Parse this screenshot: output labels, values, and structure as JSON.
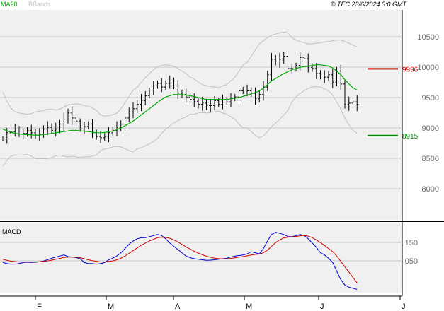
{
  "header": {
    "ma_label": "MA20",
    "bbands_label": "BBands",
    "timestamp": "© TEC 23/6/2024 3:0 GMT"
  },
  "macd_label": "MACD",
  "colors": {
    "background": "#ffffff",
    "plot_area": "#f0f0f0",
    "grid": "#c8c8c8",
    "price_bars": "#000000",
    "ma20": "#00aa00",
    "bbands": "#c0c0c0",
    "resistance": "#cc0000",
    "support": "#008800",
    "macd_line": "#0000cc",
    "signal_line": "#cc0000"
  },
  "chart_data": [
    {
      "type": "ohlc",
      "title": "",
      "x_tick_labels": [
        "F",
        "M",
        "A",
        "M",
        "J",
        "J"
      ],
      "y_tick_labels": [
        "10500",
        "10000",
        "9500",
        "9000",
        "8500",
        "8000"
      ],
      "ylim": [
        7550,
        10950
      ],
      "grid": true,
      "overlays": [
        "MA20",
        "BBands"
      ],
      "levels": [
        {
          "name": "resistance",
          "value": 9996,
          "label": "9996"
        },
        {
          "name": "support",
          "value": 8915,
          "label": "8915"
        }
      ],
      "series": [
        {
          "name": "Price",
          "closes": [
            8860,
            8960,
            8980,
            9020,
            8940,
            8950,
            9000,
            8960,
            8920,
            8940,
            9020,
            9050,
            9000,
            9020,
            9100,
            9180,
            9280,
            9200,
            9150,
            9020,
            9060,
            9100,
            8960,
            8900,
            8880,
            8900,
            8960,
            9000,
            9050,
            9100,
            9200,
            9300,
            9350,
            9420,
            9480,
            9560,
            9650,
            9720,
            9760,
            9700,
            9760,
            9800,
            9720,
            9600,
            9580,
            9540,
            9500,
            9470,
            9420,
            9440,
            9400,
            9400,
            9480,
            9420,
            9500,
            9460,
            9520,
            9540,
            9640,
            9650,
            9640,
            9600,
            9510,
            9580,
            9700,
            9900,
            10150,
            10120,
            10150,
            10200,
            10000,
            10000,
            10050,
            10180,
            10160,
            10020,
            10000,
            9920,
            9880,
            9860,
            9900,
            9780,
            9960,
            9750,
            9420,
            9440,
            9460,
            9420
          ]
        },
        {
          "name": "MA20",
          "values": [
            9020,
            8990,
            8970,
            8950,
            8940,
            8935,
            8930,
            8925,
            8920,
            8925,
            8930,
            8940,
            8950,
            8960,
            8970,
            8980,
            8990,
            9000,
            9000,
            8990,
            8985,
            8980,
            8970,
            8960,
            8960,
            8965,
            8975,
            8990,
            9010,
            9040,
            9075,
            9110,
            9150,
            9200,
            9250,
            9300,
            9350,
            9400,
            9450,
            9500,
            9540,
            9560,
            9580,
            9580,
            9575,
            9570,
            9560,
            9545,
            9530,
            9515,
            9500,
            9500,
            9500,
            9500,
            9500,
            9500,
            9510,
            9520,
            9530,
            9550,
            9570,
            9590,
            9610,
            9640,
            9680,
            9740,
            9800,
            9840,
            9880,
            9920,
            9950,
            9980,
            10000,
            10020,
            10030,
            10040,
            10050,
            10060,
            10060,
            10050,
            10040,
            10010,
            9960,
            9900,
            9820,
            9750,
            9690,
            9650
          ]
        },
        {
          "name": "BBands upper",
          "values": [
            9620,
            9470,
            9360,
            9300,
            9280,
            9270,
            9260,
            9270,
            9300,
            9310,
            9320,
            9340,
            9340,
            9330,
            9340,
            9380,
            9410,
            9420,
            9430,
            9420,
            9400,
            9390,
            9360,
            9320,
            9250,
            9230,
            9240,
            9250,
            9280,
            9350,
            9450,
            9550,
            9650,
            9700,
            9780,
            9850,
            9920,
            9980,
            10030,
            10050,
            10060,
            10050,
            10040,
            10000,
            9960,
            9920,
            9860,
            9830,
            9780,
            9740,
            9720,
            9710,
            9700,
            9690,
            9720,
            9740,
            9800,
            9860,
            9960,
            10060,
            10100,
            10200,
            10300,
            10400,
            10450,
            10500,
            10540,
            10560,
            10580,
            10590,
            10580,
            10500,
            10460,
            10440,
            10420,
            10400,
            10400,
            10410,
            10420,
            10430,
            10440,
            10450,
            10460,
            10460,
            10440,
            10410,
            10380,
            10350
          ]
        },
        {
          "name": "BBands lower",
          "values": [
            8420,
            8510,
            8580,
            8600,
            8600,
            8600,
            8610,
            8580,
            8540,
            8540,
            8540,
            8540,
            8560,
            8590,
            8600,
            8580,
            8570,
            8580,
            8570,
            8560,
            8570,
            8570,
            8580,
            8600,
            8670,
            8700,
            8710,
            8730,
            8740,
            8730,
            8700,
            8670,
            8650,
            8700,
            8720,
            8750,
            8780,
            8820,
            8870,
            8950,
            9020,
            9070,
            9120,
            9160,
            9190,
            9220,
            9260,
            9260,
            9280,
            9290,
            9280,
            9290,
            9300,
            9310,
            9280,
            9260,
            9220,
            9180,
            9100,
            9040,
            9040,
            8980,
            8920,
            8880,
            8910,
            8980,
            9060,
            9120,
            9180,
            9250,
            9320,
            9460,
            9540,
            9600,
            9640,
            9680,
            9700,
            9710,
            9700,
            9670,
            9640,
            9570,
            9460,
            9340,
            9200,
            9090,
            9000,
            8950
          ]
        }
      ]
    },
    {
      "type": "line",
      "title": "MACD",
      "y_tick_labels": [
        "150",
        "050"
      ],
      "ylim": [
        -300,
        350
      ],
      "grid": true,
      "series": [
        {
          "name": "MACD",
          "values": [
            -20,
            -30,
            -35,
            -35,
            -30,
            -20,
            -18,
            -20,
            -18,
            -14,
            -6,
            6,
            20,
            30,
            40,
            50,
            35,
            30,
            25,
            15,
            -20,
            -30,
            -30,
            -35,
            -30,
            -20,
            5,
            20,
            40,
            70,
            110,
            150,
            180,
            200,
            210,
            210,
            220,
            230,
            240,
            230,
            200,
            160,
            130,
            100,
            70,
            40,
            25,
            15,
            10,
            5,
            0,
            2,
            5,
            10,
            15,
            20,
            30,
            40,
            45,
            50,
            60,
            80,
            70,
            60,
            110,
            180,
            240,
            260,
            250,
            240,
            220,
            220,
            230,
            240,
            230,
            200,
            160,
            120,
            70,
            50,
            20,
            -20,
            -100,
            -180,
            -230,
            -250,
            -260,
            -270
          ]
        },
        {
          "name": "Signal",
          "values": [
            10,
            0,
            -8,
            -12,
            -15,
            -16,
            -16,
            -16,
            -15,
            -13,
            -10,
            -5,
            2,
            10,
            18,
            27,
            30,
            31,
            29,
            25,
            15,
            5,
            -3,
            -10,
            -15,
            -15,
            -10,
            -5,
            5,
            20,
            40,
            65,
            90,
            115,
            140,
            160,
            180,
            195,
            210,
            215,
            213,
            205,
            190,
            170,
            148,
            125,
            105,
            85,
            68,
            52,
            38,
            28,
            20,
            16,
            14,
            15,
            18,
            24,
            30,
            35,
            42,
            50,
            55,
            58,
            70,
            95,
            130,
            165,
            190,
            208,
            215,
            218,
            222,
            228,
            230,
            225,
            210,
            190,
            165,
            138,
            110,
            80,
            40,
            -10,
            -60,
            -110,
            -160,
            -210
          ]
        }
      ]
    }
  ]
}
